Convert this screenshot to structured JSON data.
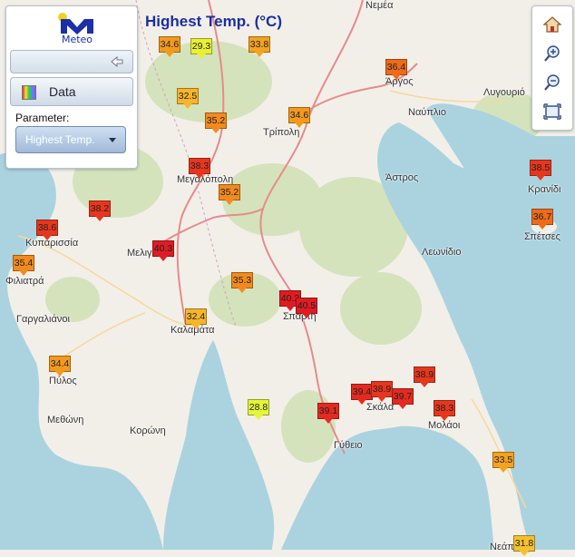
{
  "title": "Highest Temp. (°C)",
  "logo": {
    "text": "Meteo"
  },
  "panel": {
    "data_button_label": "Data",
    "parameter_label": "Parameter:",
    "parameter_value": "Highest Temp."
  },
  "colors": {
    "sea": "#aad3df",
    "land": "#f2efe9",
    "forest": "#c8dcae",
    "road": "#e67a7a",
    "title": "#1b2ea0"
  },
  "zoom_controls": [
    "home-icon",
    "zoom-in-icon",
    "zoom-out-icon",
    "fit-extent-icon"
  ],
  "cities": [
    {
      "name": "Νεμέα"
    },
    {
      "name": "Άργος"
    },
    {
      "name": "Λυγουριό"
    },
    {
      "name": "Ναύπλιο"
    },
    {
      "name": "Τρίπολη"
    },
    {
      "name": "Μεγαλόπολη"
    },
    {
      "name": "Άστρος"
    },
    {
      "name": "Κρανίδι"
    },
    {
      "name": "Σπέτσες"
    },
    {
      "name": "Κυπαρισσία"
    },
    {
      "name": "Φιλιατρά"
    },
    {
      "name": "Μελιγαλάς"
    },
    {
      "name": "Λεωνίδιο"
    },
    {
      "name": "Γαργαλιάνοι"
    },
    {
      "name": "Καλαμάτα"
    },
    {
      "name": "Σπάρτη"
    },
    {
      "name": "Πύλος"
    },
    {
      "name": "Σκάλα"
    },
    {
      "name": "Μολάοι"
    },
    {
      "name": "Μεθώνη"
    },
    {
      "name": "Κορώνη"
    },
    {
      "name": "Γύθειο"
    },
    {
      "name": "Νεάπολη"
    }
  ],
  "stations": [
    {
      "value": "34.6",
      "color": "#f39a1c"
    },
    {
      "value": "29.3",
      "color": "#e8f034"
    },
    {
      "value": "33.8",
      "color": "#f4a21f"
    },
    {
      "value": "36.4",
      "color": "#ee6b1a"
    },
    {
      "value": "32.5",
      "color": "#f6b52a"
    },
    {
      "value": "35.2",
      "color": "#f38a1e"
    },
    {
      "value": "34.6",
      "color": "#f39a1c"
    },
    {
      "value": "38.3",
      "color": "#e8361e"
    },
    {
      "value": "35.2",
      "color": "#f38a1e"
    },
    {
      "value": "38.5",
      "color": "#e8361e"
    },
    {
      "value": "38.2",
      "color": "#e8361e"
    },
    {
      "value": "38.6",
      "color": "#e8361e"
    },
    {
      "value": "36.7",
      "color": "#ee6b1a"
    },
    {
      "value": "40.3",
      "color": "#e01c22"
    },
    {
      "value": "35.4",
      "color": "#f38a1e"
    },
    {
      "value": "35.3",
      "color": "#f38a1e"
    },
    {
      "value": "40.2",
      "color": "#e01c22"
    },
    {
      "value": "40.5",
      "color": "#e01c22"
    },
    {
      "value": "34.4",
      "color": "#f39a1c"
    },
    {
      "value": "32.4",
      "color": "#f6b52a"
    },
    {
      "value": "38.9",
      "color": "#e8361e"
    },
    {
      "value": "39.4",
      "color": "#e42a20"
    },
    {
      "value": "38.9",
      "color": "#e8361e"
    },
    {
      "value": "39.7",
      "color": "#e42a20"
    },
    {
      "value": "38.3",
      "color": "#e8361e"
    },
    {
      "value": "28.8",
      "color": "#e4f53a"
    },
    {
      "value": "39.1",
      "color": "#e42a20"
    },
    {
      "value": "33.5",
      "color": "#f4a21f"
    },
    {
      "value": "31.8",
      "color": "#f6c02e"
    }
  ]
}
